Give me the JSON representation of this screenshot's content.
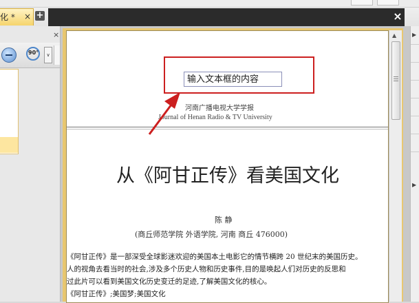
{
  "tabs": {
    "doc_tab_label": "化 *",
    "doc_tab_close": "×",
    "new_tab": "+",
    "close_all": "×"
  },
  "left_panel": {
    "close": "×",
    "rotate_label": "90°",
    "dropdown_glyph": "∨"
  },
  "page": {
    "text_field_value": "输入文本框的内容",
    "journal_cn": "河南广播电视大学学报",
    "journal_en": "Journal of Henan Radio & TV University",
    "title": "从《阿甘正传》看美国文化",
    "author": "陈  静",
    "affiliation": "(商丘师范学院  外语学院, 河南  商丘  476000)",
    "body_lines": [
      "《阿甘正传》是一部深受全球影迷欢迎的美国本土电影它的情节横跨 20 世纪末的美国历史。",
      "人的视角去看当时的社会,涉及多个历史人物和历史事件,目的是唤起人们对历史的反思和",
      "过此片可以看到美国文化历史变迁的足迹,了解美国文化的核心。",
      "《阿甘正传》;美国梦;美国文化"
    ]
  },
  "colors": {
    "annotation": "#cc1f1f",
    "tab_active": "#f5d46c",
    "frame": "#e8c770"
  }
}
